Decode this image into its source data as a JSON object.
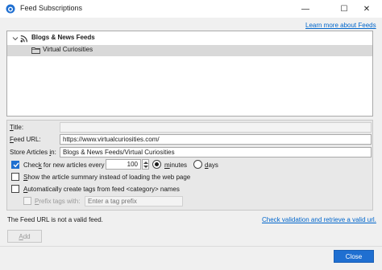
{
  "window": {
    "title": "Feed Subscriptions",
    "minimize_glyph": "—",
    "maximize_glyph": "☐",
    "close_glyph": "✕"
  },
  "header": {
    "learn_more_link": "Learn more about Feeds"
  },
  "tree": {
    "parent": {
      "label": "Blogs & News Feeds",
      "expanded": true,
      "icon": "rss-icon"
    },
    "child": {
      "label": "Virtual Curiosities",
      "icon": "folder-icon",
      "selected": true
    }
  },
  "form": {
    "title_label_u": "T",
    "title_label_rest": "itle:",
    "title_value": "",
    "feed_url_label_u": "F",
    "feed_url_label_rest": "eed URL:",
    "feed_url_value": "https://www.virtualcuriosities.com/",
    "store_label_pre": "Store Articles ",
    "store_label_u": "i",
    "store_label_rest": "n:",
    "store_value": "Blogs & News Feeds/Virtual Curiosities",
    "check_label_pre": "Chec",
    "check_label_u": "k",
    "check_label_rest": " for new articles every",
    "check_enabled": true,
    "interval_value": "100",
    "minutes_label_pre": "",
    "minutes_label_u": "m",
    "minutes_label_rest": "inutes",
    "minutes_selected": true,
    "days_label_pre": "",
    "days_label_u": "d",
    "days_label_rest": "ays",
    "summary_label_u": "S",
    "summary_label_rest": "how the article summary instead of loading the web page",
    "summary_checked": false,
    "auto_tags_label_u": "A",
    "auto_tags_label_rest": "utomatically create tags from feed <category> names",
    "auto_tags_checked": false,
    "prefix_label_u": "P",
    "prefix_label_rest": "refix tags with:",
    "prefix_checked": false,
    "prefix_placeholder": "Enter a tag prefix"
  },
  "status": {
    "message": "The Feed URL is not a valid feed.",
    "check_link": "Check validation and retrieve a valid url."
  },
  "buttons": {
    "add_label": "Add",
    "add_label_u": "A",
    "add_label_rest": "dd",
    "close_label": "Close"
  },
  "colors": {
    "accent": "#1f6fd1",
    "link": "#0066cc",
    "selection": "#d9d9d9"
  }
}
